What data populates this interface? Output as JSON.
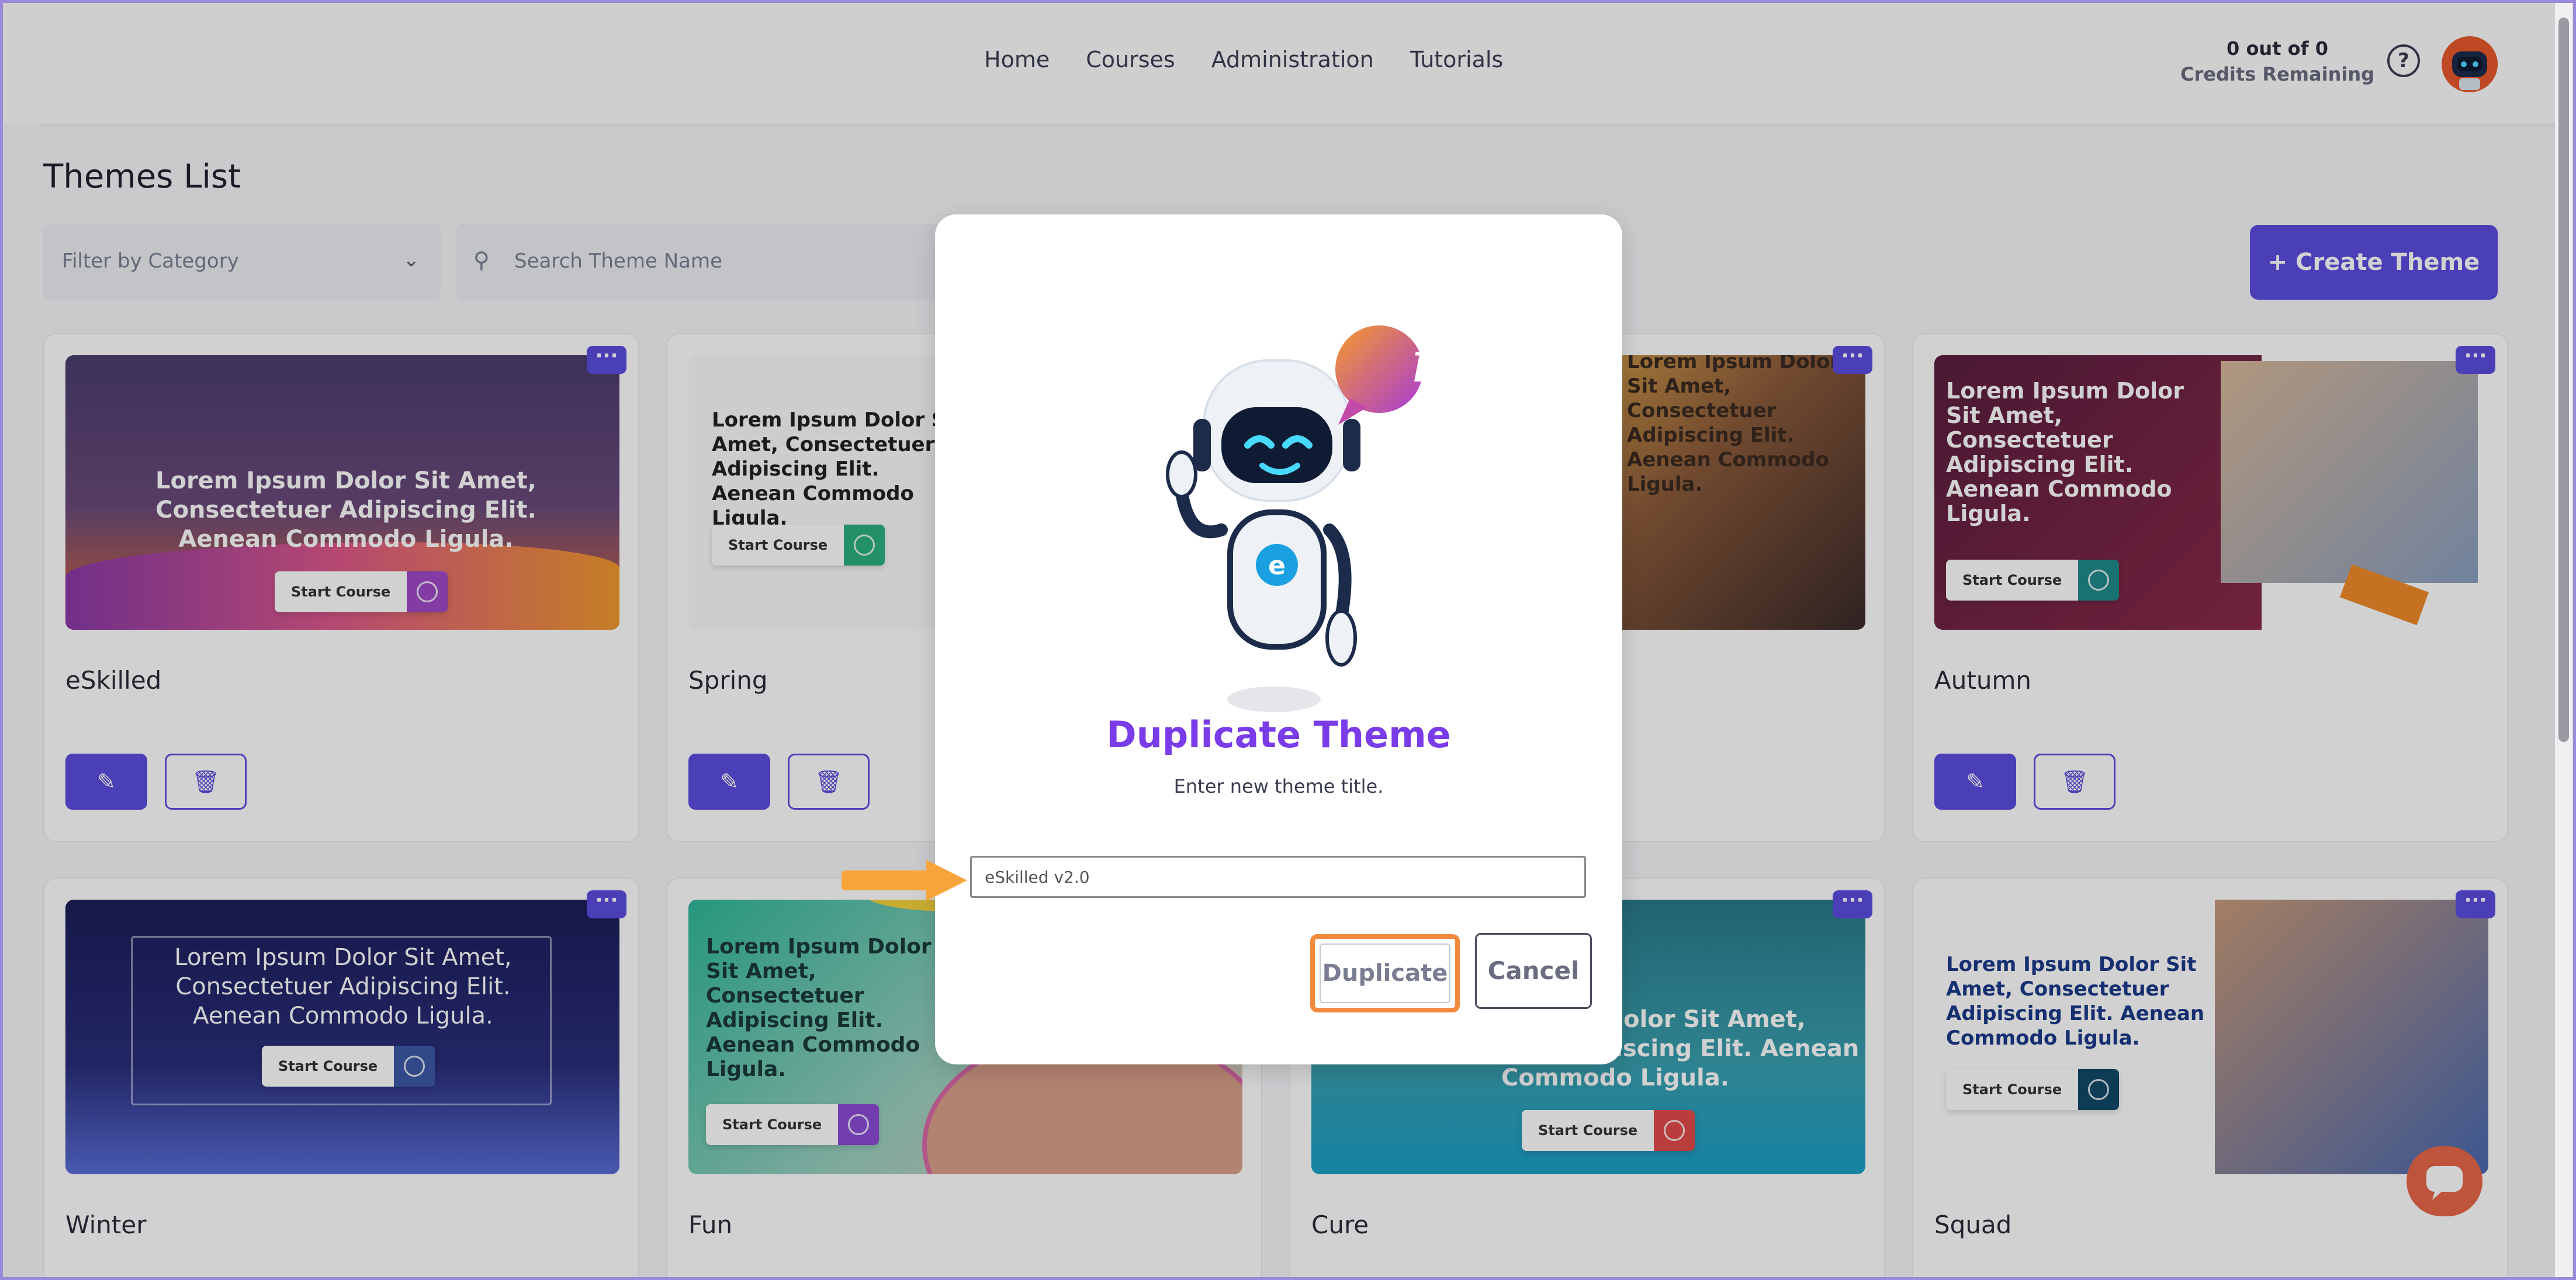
{
  "nav": {
    "links": [
      "Home",
      "Courses",
      "Administration",
      "Tutorials"
    ],
    "credits_line1": "0 out of 0",
    "credits_line2": "Credits Remaining",
    "help": "?"
  },
  "page": {
    "title": "Themes List",
    "filter_placeholder": "Filter by Category",
    "search_placeholder": "Search Theme Name",
    "create_button": "+ Create Theme"
  },
  "thumb_text": {
    "lorem_long": "Lorem Ipsum Dolor Sit Amet, Consectetuer Adipiscing Elit. Aenean Commodo Ligula.",
    "start_course": "Start Course",
    "more": "···"
  },
  "cards": [
    {
      "name": "eSkilled",
      "accent": "#5b4ee0"
    },
    {
      "name": "Spring",
      "accent": "#2bb07f"
    },
    {
      "name": "",
      "accent": "#e96a3a"
    },
    {
      "name": "Autumn",
      "accent": "#1f8a8a"
    },
    {
      "name": "Winter",
      "accent": "#3c5aa6"
    },
    {
      "name": "Fun",
      "accent": "#8a4bd6"
    },
    {
      "name": "Cure",
      "accent": "#e24b4b"
    },
    {
      "name": "Squad",
      "accent": "#124a6a"
    }
  ],
  "modal": {
    "title": "Duplicate Theme",
    "subtitle": "Enter new theme title.",
    "input_value": "eSkilled v2.0",
    "duplicate_button": "Duplicate",
    "cancel_button": "Cancel",
    "info_badge": "i"
  },
  "colors": {
    "primary": "#5b4ee0",
    "modal_title": "#7a3be8",
    "highlight": "#f28a3e"
  }
}
